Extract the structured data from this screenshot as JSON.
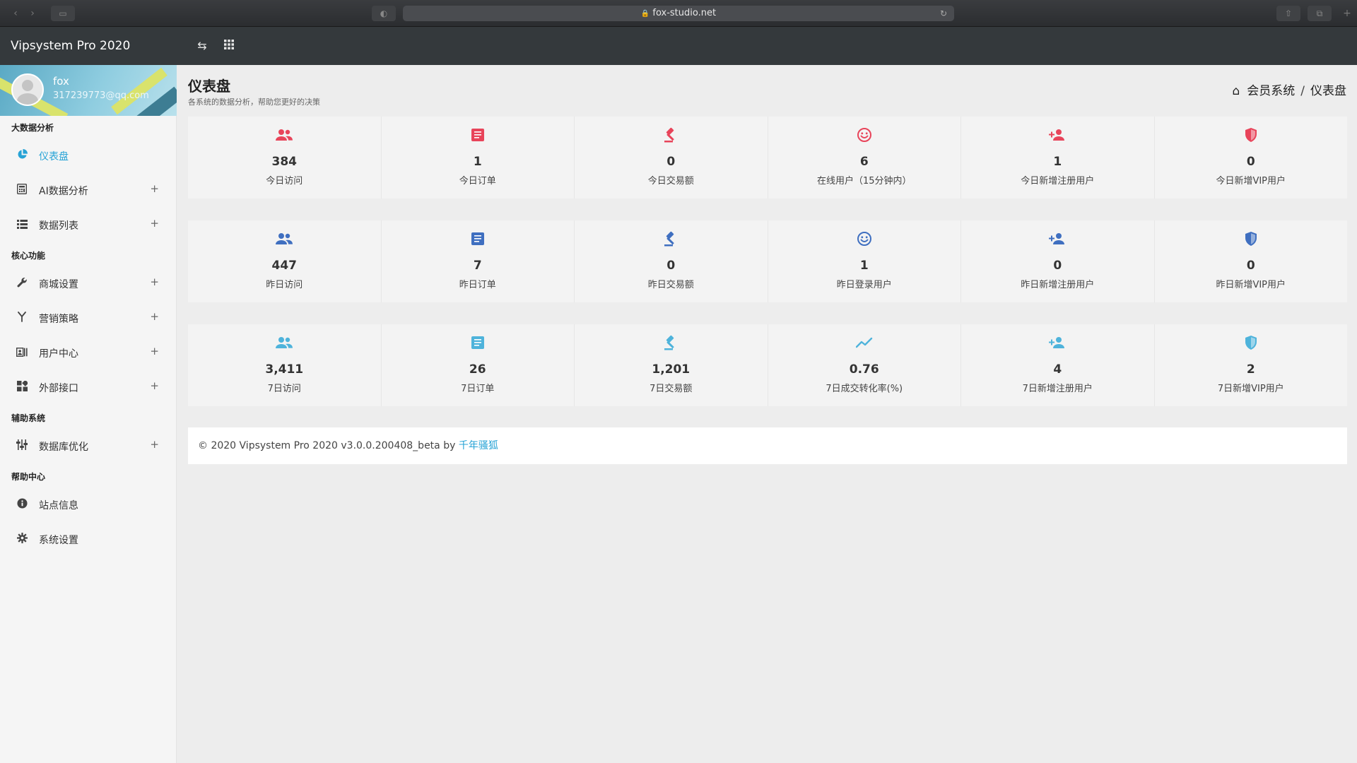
{
  "browser": {
    "url": "fox-studio.net",
    "lock_icon": "lock-icon",
    "reload_icon": "reload-icon"
  },
  "header": {
    "title": "Vipsystem Pro 2020",
    "icons": [
      "swap-icon",
      "grid-icon"
    ]
  },
  "sidebar": {
    "user": {
      "name": "fox",
      "email": "317239773@qq.com"
    },
    "sections": [
      {
        "title": "大数据分析",
        "items": [
          {
            "label": "仪表盘",
            "icon": "pie-chart-icon",
            "active": true,
            "expandable": false
          },
          {
            "label": "AI数据分析",
            "icon": "calculator-icon",
            "active": false,
            "expandable": true
          },
          {
            "label": "数据列表",
            "icon": "list-icon",
            "active": false,
            "expandable": true
          }
        ]
      },
      {
        "title": "核心功能",
        "items": [
          {
            "label": "商城设置",
            "icon": "wrench-icon",
            "active": false,
            "expandable": true
          },
          {
            "label": "营销策略",
            "icon": "fork-icon",
            "active": false,
            "expandable": true
          },
          {
            "label": "用户中心",
            "icon": "id-card-icon",
            "active": false,
            "expandable": true
          },
          {
            "label": "外部接口",
            "icon": "widgets-icon",
            "active": false,
            "expandable": true
          }
        ]
      },
      {
        "title": "辅助系统",
        "items": [
          {
            "label": "数据库优化",
            "icon": "sliders-icon",
            "active": false,
            "expandable": true
          }
        ]
      },
      {
        "title": "帮助中心",
        "items": [
          {
            "label": "站点信息",
            "icon": "info-icon",
            "active": false,
            "expandable": false
          },
          {
            "label": "系统设置",
            "icon": "gear-icon",
            "active": false,
            "expandable": false
          }
        ]
      }
    ],
    "plus_symbol": "+"
  },
  "page": {
    "title": "仪表盘",
    "subtitle": "各系统的数据分析，帮助您更好的决策",
    "breadcrumb": [
      "会员系统",
      "仪表盘"
    ],
    "breadcrumb_sep": "/"
  },
  "stats": {
    "colors": [
      "#e8445a",
      "#3f6fc0",
      "#4eb3db"
    ],
    "rows": [
      [
        {
          "icon": "users-icon",
          "value": "384",
          "label": "今日访问"
        },
        {
          "icon": "document-icon",
          "value": "1",
          "label": "今日订单"
        },
        {
          "icon": "gavel-icon",
          "value": "0",
          "label": "今日交易额"
        },
        {
          "icon": "smile-icon",
          "value": "6",
          "label": "在线用户（15分钟内）"
        },
        {
          "icon": "user-plus-icon",
          "value": "1",
          "label": "今日新增注册用户"
        },
        {
          "icon": "shield-icon",
          "value": "0",
          "label": "今日新增VIP用户"
        }
      ],
      [
        {
          "icon": "users-icon",
          "value": "447",
          "label": "昨日访问"
        },
        {
          "icon": "document-icon",
          "value": "7",
          "label": "昨日订单"
        },
        {
          "icon": "gavel-icon",
          "value": "0",
          "label": "昨日交易额"
        },
        {
          "icon": "smile-icon",
          "value": "1",
          "label": "昨日登录用户"
        },
        {
          "icon": "user-plus-icon",
          "value": "0",
          "label": "昨日新增注册用户"
        },
        {
          "icon": "shield-icon",
          "value": "0",
          "label": "昨日新增VIP用户"
        }
      ],
      [
        {
          "icon": "users-icon",
          "value": "3,411",
          "label": "7日访问"
        },
        {
          "icon": "document-icon",
          "value": "26",
          "label": "7日订单"
        },
        {
          "icon": "gavel-icon",
          "value": "1,201",
          "label": "7日交易额"
        },
        {
          "icon": "trend-icon",
          "value": "0.76",
          "label": "7日成交转化率(%)"
        },
        {
          "icon": "user-plus-icon",
          "value": "4",
          "label": "7日新增注册用户"
        },
        {
          "icon": "shield-icon",
          "value": "2",
          "label": "7日新增VIP用户"
        }
      ]
    ]
  },
  "footer": {
    "text": "© 2020 Vipsystem Pro 2020 v3.0.0.200408_beta by ",
    "link": "千年骚狐"
  }
}
